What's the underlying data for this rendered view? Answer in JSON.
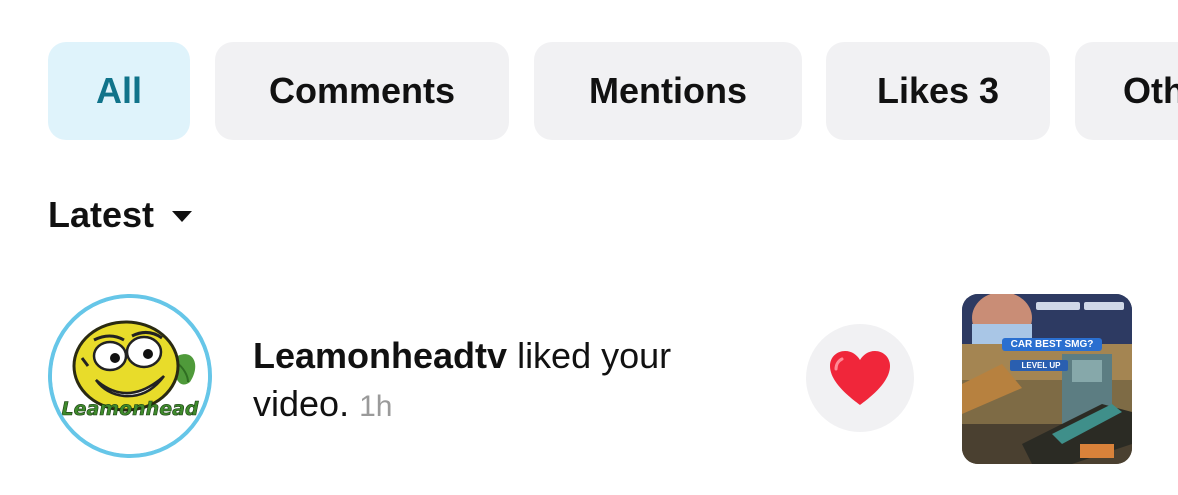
{
  "filters": {
    "tabs": [
      {
        "label": "All",
        "active": true
      },
      {
        "label": "Comments",
        "active": false
      },
      {
        "label": "Mentions",
        "active": false
      },
      {
        "label": "Likes 3",
        "active": false
      },
      {
        "label": "Oth",
        "active": false
      }
    ]
  },
  "sort": {
    "label": "Latest",
    "icon": "caret-down-icon"
  },
  "notification": {
    "avatar_text": "Leamonhead",
    "username": "Leamonheadtv",
    "action": " liked your video.",
    "time": "1h",
    "reaction_icon": "heart-icon",
    "thumbnail": {
      "caption": "CAR BEST SMG?",
      "badge": "LEVEL UP"
    }
  },
  "colors": {
    "active_tab_bg": "#dff3fb",
    "active_tab_text": "#10738a",
    "tab_bg": "#f1f1f3",
    "heart": "#f0263a",
    "avatar_ring": "#66c6e8"
  }
}
